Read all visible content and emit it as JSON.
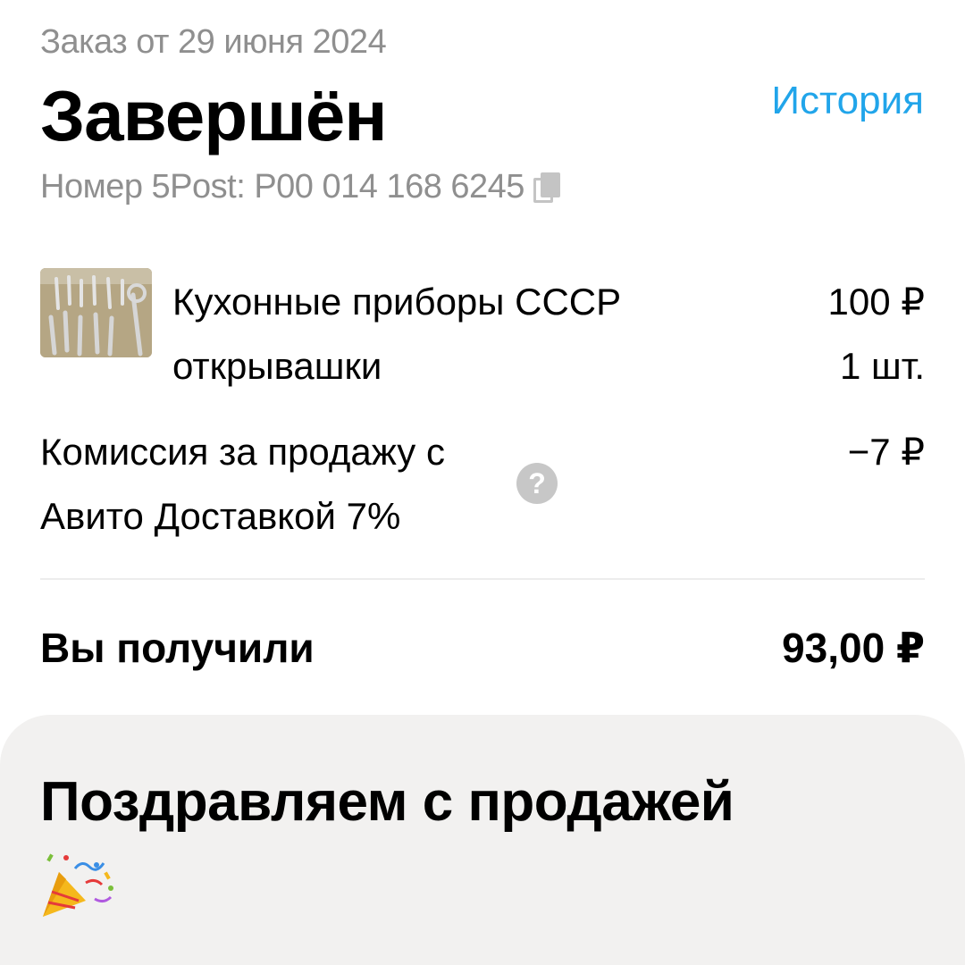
{
  "header": {
    "order_date": "Заказ от 29 июня 2024",
    "status": "Завершён",
    "history_link": "История",
    "tracking_label": "Номер 5Post: Р00 014 168 6245"
  },
  "product": {
    "name": "Кухонные приборы СССР открывашки",
    "price": "100 ₽",
    "quantity": "1 шт."
  },
  "commission": {
    "label": "Комиссия за продажу с Авито Доставкой 7%",
    "amount": "−7 ₽",
    "help_glyph": "?"
  },
  "total": {
    "label": "Вы получили",
    "amount": "93,00 ₽"
  },
  "congrats": {
    "title": "Поздравляем с продажей"
  },
  "icons": [
    "copy-icon",
    "question-icon",
    "party-popper-icon"
  ],
  "colors": {
    "accent_link": "#21a5ea",
    "muted_text": "#8f8f8f",
    "card_background": "#f2f1f0"
  }
}
